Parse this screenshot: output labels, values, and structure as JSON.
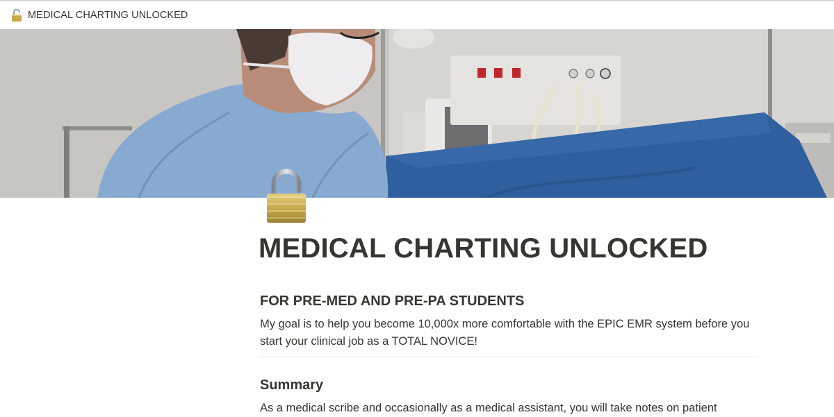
{
  "topbar": {
    "icon": "unlocked-padlock-icon",
    "title": "MEDICAL CHARTING UNLOCKED"
  },
  "cover": {
    "description_icon": "operating-room-cover-image"
  },
  "page": {
    "icon": "unlocked-padlock-icon",
    "title": "MEDICAL CHARTING UNLOCKED",
    "subtitle": "FOR PRE-MED AND PRE-PA STUDENTS",
    "intro": "My goal is to help you become 10,000x more comfortable with the EPIC EMR system before you start your clinical job as a TOTAL NOVICE!",
    "summary_heading": "Summary",
    "summary_text": "As a medical scribe and occasionally as a medical assistant, you will take notes on patient"
  },
  "colors": {
    "text": "#37352f",
    "divider": "#e3e2df",
    "gown": "#7fa3cc",
    "drape": "#2f5f9e"
  }
}
